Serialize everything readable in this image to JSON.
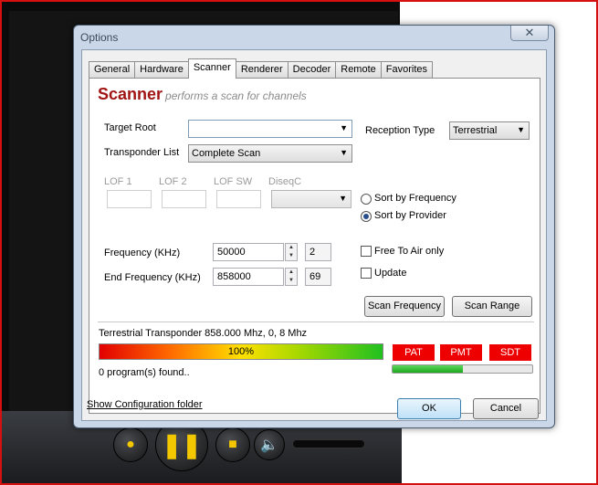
{
  "dialog": {
    "title": "Options",
    "close_label": "✕",
    "tabs": [
      "General",
      "Hardware",
      "Scanner",
      "Renderer",
      "Decoder",
      "Remote",
      "Favorites"
    ],
    "active_tab": "Scanner"
  },
  "panel": {
    "title": "Scanner",
    "subtitle": "performs a scan for channels"
  },
  "form": {
    "target_root_label": "Target Root",
    "target_root_value": "",
    "transponder_list_label": "Transponder List",
    "transponder_list_value": "Complete Scan",
    "reception_type_label": "Reception Type",
    "reception_type_value": "Terrestrial",
    "lof1_label": "LOF 1",
    "lof2_label": "LOF 2",
    "lofsw_label": "LOF SW",
    "diseqc_label": "DiseqC",
    "sort_frequency_label": "Sort by Frequency",
    "sort_provider_label": "Sort by Provider",
    "sort_selected": "Sort by Provider",
    "frequency_label": "Frequency (KHz)",
    "frequency_value": "50000",
    "frequency_channel": "2",
    "end_frequency_label": "End Frequency (KHz)",
    "end_frequency_value": "858000",
    "end_frequency_channel": "69",
    "free_to_air_label": "Free To Air only",
    "free_to_air_checked": false,
    "update_label": "Update",
    "update_checked": false,
    "scan_frequency_button": "Scan Frequency",
    "scan_range_button": "Scan Range"
  },
  "status": {
    "transponder_text": "Terrestrial Transponder 858.000 Mhz, 0, 8 Mhz",
    "signal_level": "100%",
    "signal_level_fraction": 1.0,
    "indicators": [
      "PAT",
      "PMT",
      "SDT"
    ],
    "indicator_color": "#ee0000",
    "quality_fraction": 0.5,
    "found_text": "0 program(s) found.."
  },
  "footer": {
    "config_link": "Show Configuration folder",
    "ok_button": "OK",
    "cancel_button": "Cancel"
  },
  "player": {
    "icons": [
      "previous-icon",
      "pause-icon",
      "stop-icon",
      "volume-icon"
    ]
  }
}
